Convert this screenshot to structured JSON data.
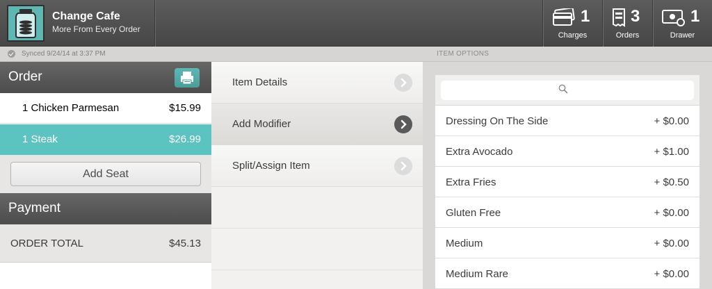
{
  "app": {
    "name": "Change Cafe",
    "tagline": "More From Every Order"
  },
  "counters": [
    {
      "icon": "credit-card-icon",
      "count": "1",
      "label": "Charges"
    },
    {
      "icon": "receipt-icon",
      "count": "3",
      "label": "Orders"
    },
    {
      "icon": "cash-drawer-icon",
      "count": "1",
      "label": "Drawer"
    }
  ],
  "status": {
    "sync_text": "Synced 9/24/14 at 3:37 PM",
    "panel_title": "ITEM OPTIONS"
  },
  "order": {
    "title": "Order",
    "items": [
      {
        "name": "1 Chicken Parmesan",
        "price": "$15.99",
        "selected": false
      },
      {
        "name": "1 Steak",
        "price": "$26.99",
        "selected": true
      }
    ],
    "add_seat_label": "Add Seat"
  },
  "payment": {
    "title": "Payment",
    "total_label": "ORDER TOTAL",
    "total_value": "$45.13"
  },
  "item_menu": [
    {
      "label": "Item Details",
      "active": false
    },
    {
      "label": "Add Modifier",
      "active": true
    },
    {
      "label": "Split/Assign Item",
      "active": false
    }
  ],
  "options": {
    "search_placeholder": "",
    "items": [
      {
        "name": "Dressing On The Side",
        "price": "+ $0.00"
      },
      {
        "name": "Extra Avocado",
        "price": "+ $1.00"
      },
      {
        "name": "Extra Fries",
        "price": "+ $0.50"
      },
      {
        "name": "Gluten Free",
        "price": "+ $0.00"
      },
      {
        "name": "Medium",
        "price": "+ $0.00"
      },
      {
        "name": "Medium Rare",
        "price": "+ $0.00"
      }
    ]
  },
  "colors": {
    "accent": "#5bc3c0",
    "header": "#4c4c4c",
    "topbar": "#4f4f4f"
  }
}
